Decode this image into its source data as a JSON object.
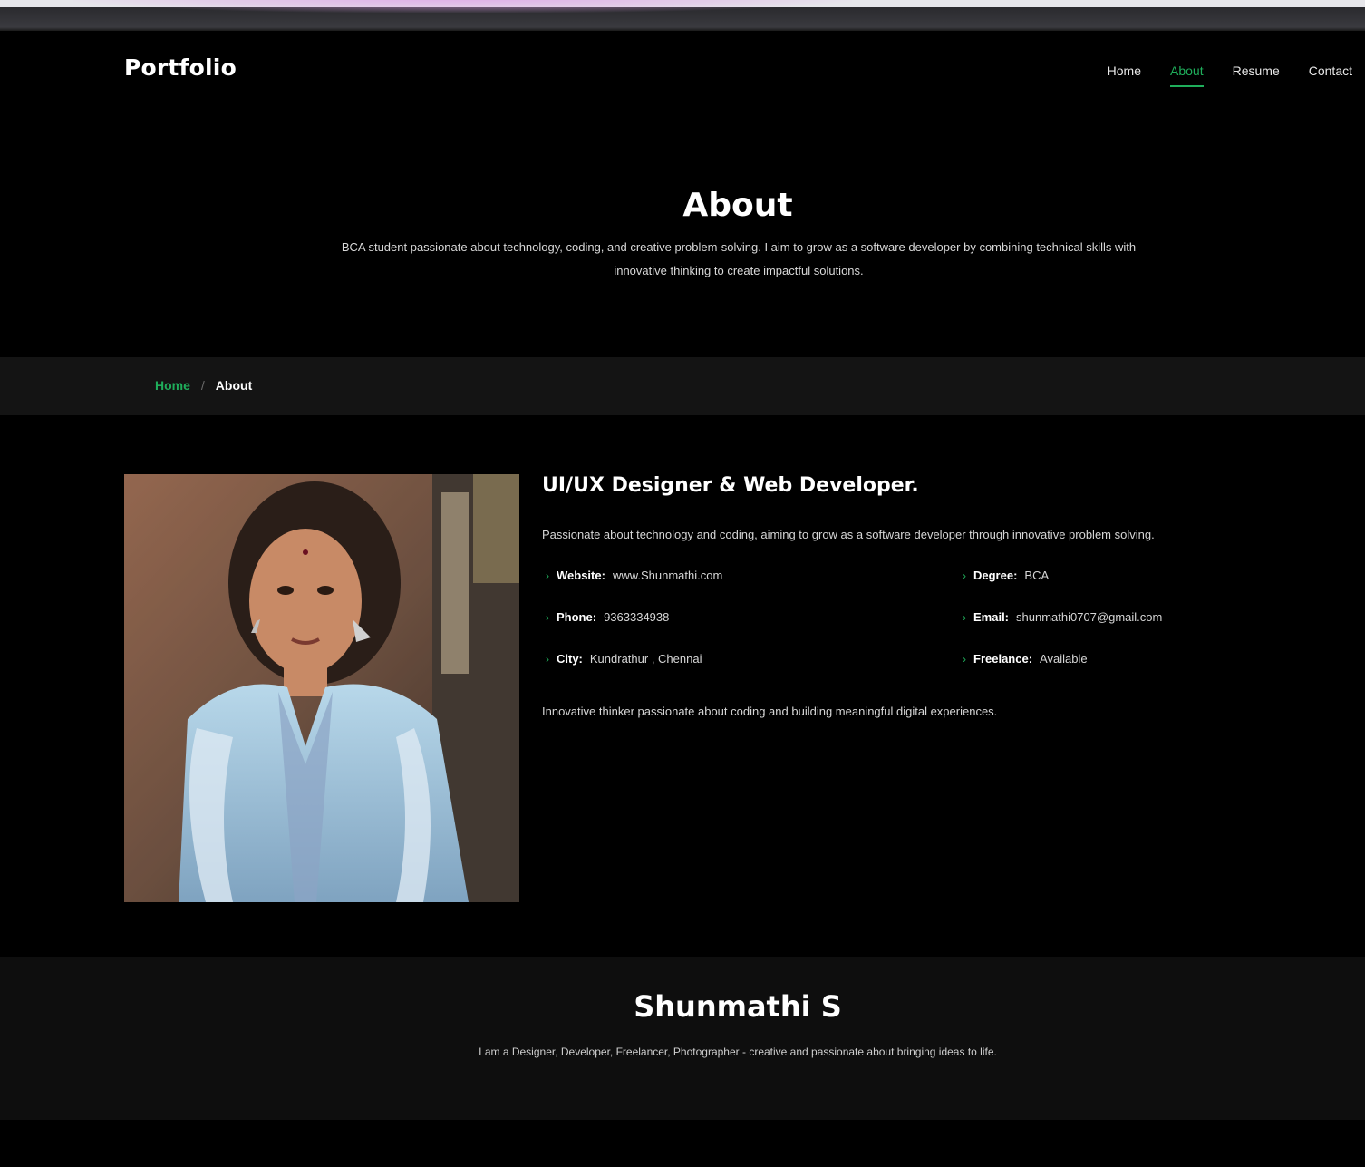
{
  "header": {
    "logo": "Portfolio",
    "nav": [
      {
        "label": "Home",
        "active": false
      },
      {
        "label": "About",
        "active": true
      },
      {
        "label": "Resume",
        "active": false
      },
      {
        "label": "Contact",
        "active": false
      }
    ]
  },
  "hero": {
    "title": "About",
    "description": "BCA student passionate about technology, coding, and creative problem-solving. I aim to grow as a software developer by combining technical skills with innovative thinking to create impactful solutions."
  },
  "breadcrumb": {
    "home": "Home",
    "separator": "/",
    "current": "About"
  },
  "profile": {
    "photo_icon": "profile-photo",
    "role_title": "UI/UX Designer & Web Developer.",
    "intro": "Passionate about technology and coding, aiming to grow as a software developer through innovative problem solving.",
    "details_left": [
      {
        "key": "Website:",
        "value": "www.Shunmathi.com"
      },
      {
        "key": "Phone:",
        "value": "9363334938"
      },
      {
        "key": "City:",
        "value": "Kundrathur , Chennai"
      }
    ],
    "details_right": [
      {
        "key": "Degree:",
        "value": "BCA"
      },
      {
        "key": "Email:",
        "value": "shunmathi0707@gmail.com"
      },
      {
        "key": "Freelance:",
        "value": "Available"
      }
    ],
    "outro": "Innovative thinker passionate about coding and building meaningful digital experiences."
  },
  "footer": {
    "name": "Shunmathi S",
    "tagline": "I am a Designer, Developer, Freelancer, Photographer - creative and passionate about bringing ideas to life."
  },
  "colors": {
    "accent": "#1fae5b",
    "background": "#000000",
    "band": "#141414"
  }
}
